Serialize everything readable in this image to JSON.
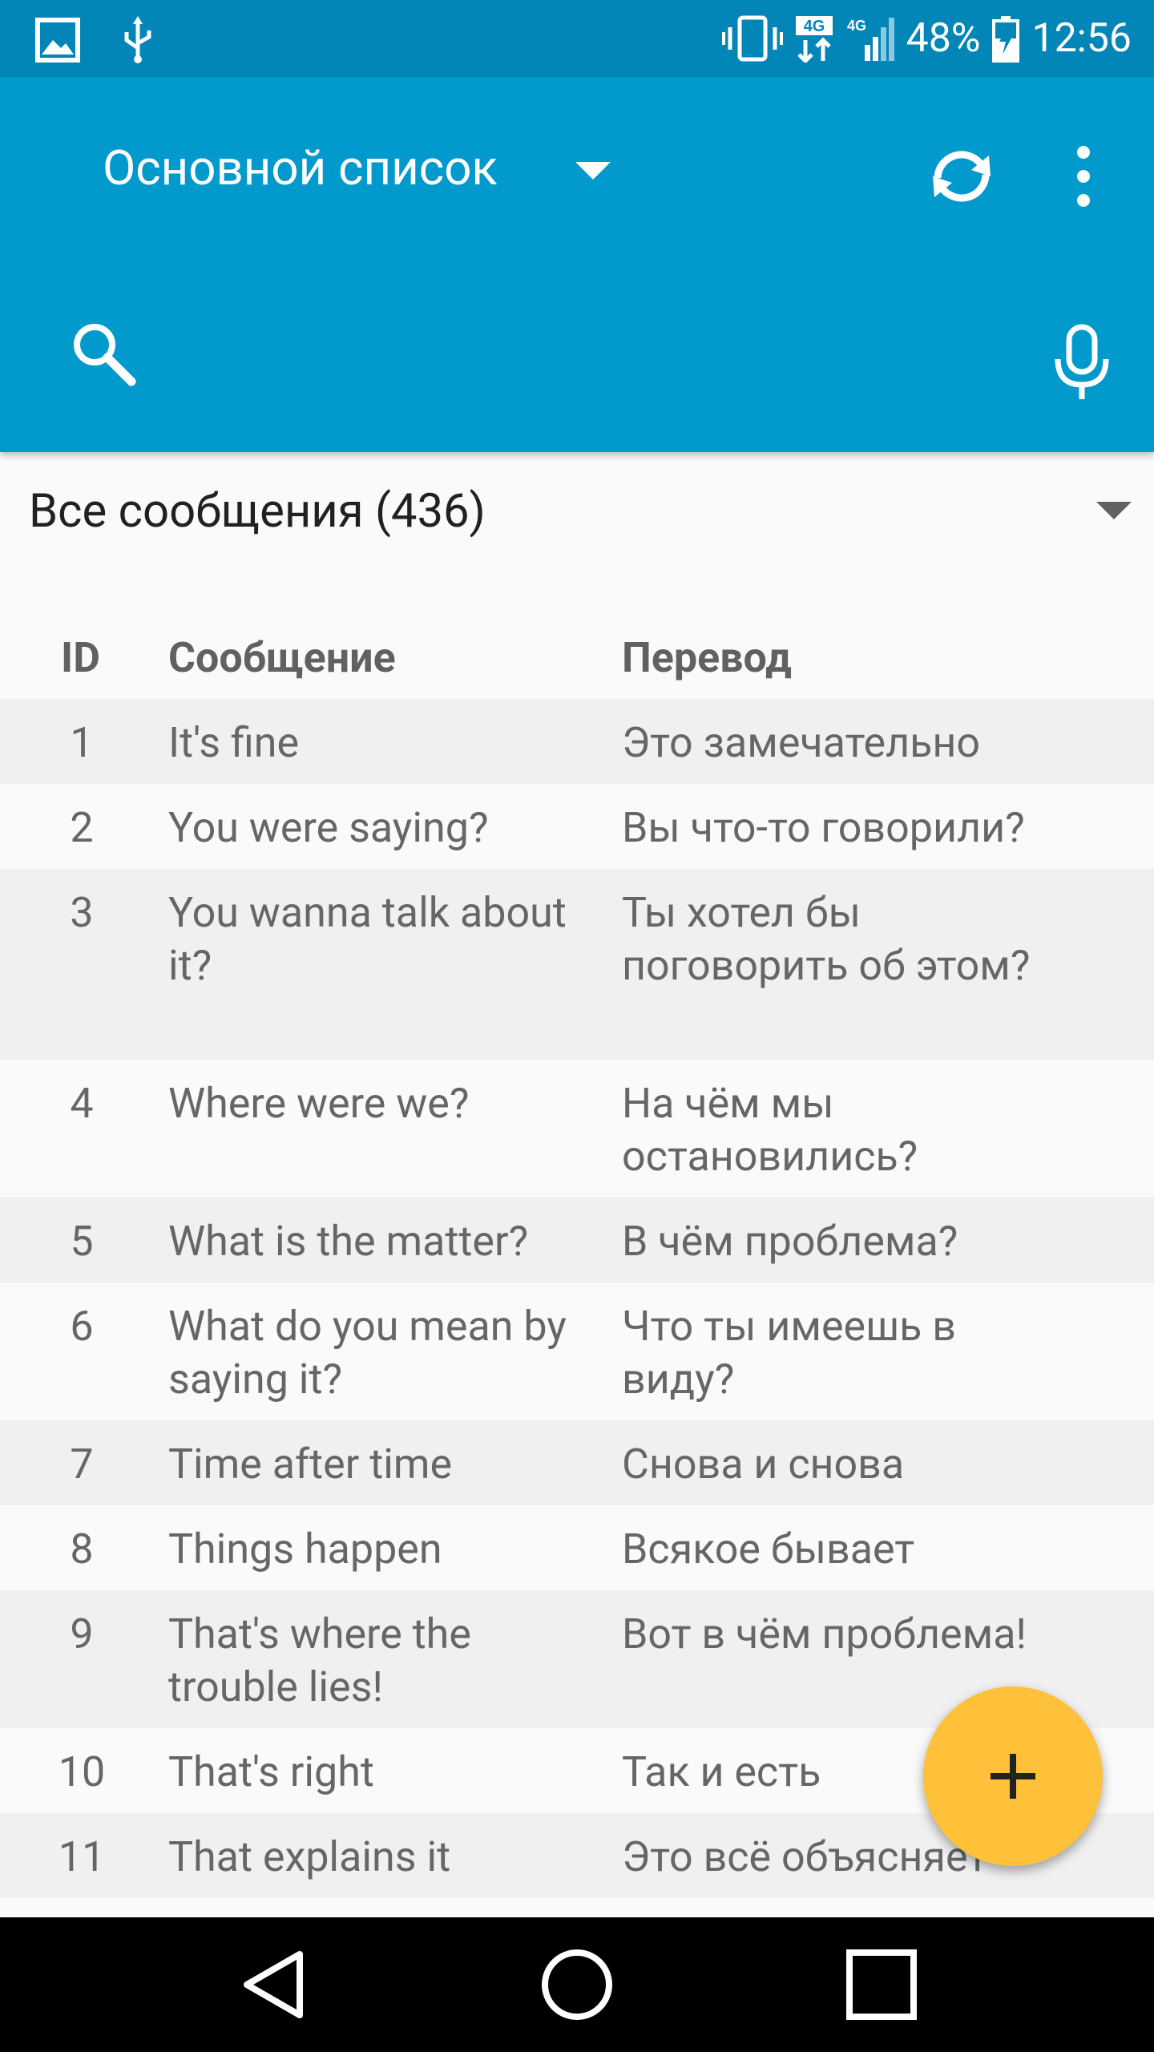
{
  "status_bar": {
    "battery_percent": "48%",
    "time": "12:56",
    "network": "4G"
  },
  "app_bar": {
    "list_title": "Основной список",
    "search": {
      "value": "",
      "placeholder": ""
    }
  },
  "filter": {
    "label": "Все сообщения (436)"
  },
  "table": {
    "headers": {
      "id": "ID",
      "message": "Сообщение",
      "translation": "Перевод"
    },
    "rows": [
      {
        "id": "1",
        "message": "It's fine",
        "translation": "Это замечательно",
        "lines": 1
      },
      {
        "id": "2",
        "message": "You were saying?",
        "translation": "Вы что-то говорили?",
        "lines": 1
      },
      {
        "id": "3",
        "message": "You wanna talk about it?",
        "translation": "Ты хотел бы поговорить об этом?",
        "lines": 3
      },
      {
        "id": "4",
        "message": "Where were we?",
        "translation": "На чём мы остановились?",
        "lines": 2
      },
      {
        "id": "5",
        "message": "What is the matter?",
        "translation": "В чём проблема?",
        "lines": 1
      },
      {
        "id": "6",
        "message": "What do you mean by saying it?",
        "translation": "Что ты имеешь в виду?",
        "lines": 2
      },
      {
        "id": "7",
        "message": "Time after time",
        "translation": "Снова и снова",
        "lines": 1
      },
      {
        "id": "8",
        "message": "Things happen",
        "translation": "Всякое бывает",
        "lines": 1
      },
      {
        "id": "9",
        "message": "That's where the trouble lies!",
        "translation": "Вот в чём проблема!",
        "lines": 2
      },
      {
        "id": "10",
        "message": "That's right",
        "translation": "Так и есть",
        "lines": 1
      },
      {
        "id": "11",
        "message": "That explains it",
        "translation": "Это всё объясняет",
        "lines": 1
      }
    ]
  },
  "fab": {
    "icon": "plus-icon"
  },
  "nav_bar": {
    "icons": [
      "back-icon",
      "home-icon",
      "recents-icon"
    ]
  },
  "colors": {
    "status_bar": "#0286b8",
    "app_bar": "#0299cc",
    "fab": "#ffc03a",
    "row_alt": "#f0f0f0"
  }
}
